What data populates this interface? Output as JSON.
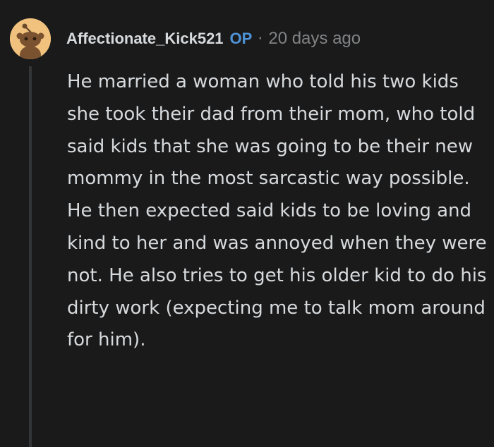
{
  "comment": {
    "author": "Affectionate_Kick521",
    "op_badge": "OP",
    "separator": "·",
    "timestamp": "20 days ago",
    "avatar_icon": "snoo-avatar-icon",
    "body": "He married a woman who told his two kids she took their dad from their mom, who told said kids that she was going to be their new mommy in the most sarcastic way possible. He then expected said kids to be loving and kind to her and was annoyed when they were not. He also tries to get his older kid to do his dirty work (expecting me to talk mom around for him)."
  },
  "colors": {
    "background": "#1a1a1b",
    "text": "#d7dadc",
    "meta": "#818384",
    "op_accent": "#4e93d8",
    "thread_line": "#343536",
    "avatar_bg": "#f1c27d"
  }
}
